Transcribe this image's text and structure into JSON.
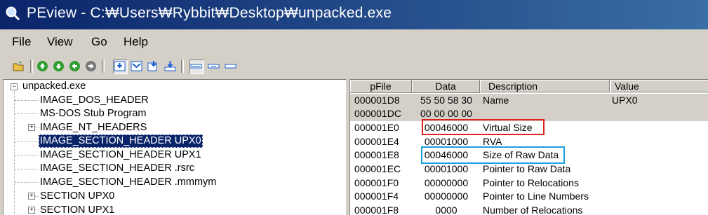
{
  "window": {
    "title": "PEview - C:₩Users₩Rybbit₩Desktop₩unpacked.exe"
  },
  "menu": [
    "File",
    "View",
    "Go",
    "Help"
  ],
  "toolbar": {
    "icons": [
      "open-folder-icon",
      "back-icon",
      "forward-icon",
      "up-icon",
      "down-icon",
      "stop-icon",
      "view-byte-icon",
      "view-word-icon",
      "view-dword-icon",
      "view-qword-icon",
      "layout-1-icon",
      "layout-2-icon",
      "layout-3-icon"
    ],
    "colors": {
      "green": "#2e9d2e",
      "blue": "#1a5fd0",
      "gray": "#606060"
    }
  },
  "tree": {
    "nodes": [
      {
        "label": "unpacked.exe",
        "expander": "−"
      },
      {
        "label": "IMAGE_DOS_HEADER"
      },
      {
        "label": "MS-DOS Stub Program"
      },
      {
        "label": "IMAGE_NT_HEADERS",
        "expander": "+"
      },
      {
        "label": "IMAGE_SECTION_HEADER UPX0",
        "selected": true
      },
      {
        "label": "IMAGE_SECTION_HEADER UPX1"
      },
      {
        "label": "IMAGE_SECTION_HEADER .rsrc"
      },
      {
        "label": "IMAGE_SECTION_HEADER .mmmym"
      },
      {
        "label": "SECTION UPX0",
        "expander": "+"
      },
      {
        "label": "SECTION UPX1",
        "expander": "+"
      }
    ]
  },
  "list": {
    "columns": [
      "pFile",
      "Data",
      "Description",
      "Value"
    ],
    "rows": [
      {
        "pfile": "000001D8",
        "data": "55  50  58  30",
        "desc": "Name",
        "value": "UPX0",
        "hi": true
      },
      {
        "pfile": "000001DC",
        "data": "00  00  00  00",
        "desc": "",
        "value": "",
        "hi": true
      },
      {
        "pfile": "000001E0",
        "data": "00046000",
        "desc": "Virtual Size",
        "value": ""
      },
      {
        "pfile": "000001E4",
        "data": "00001000",
        "desc": "RVA",
        "value": ""
      },
      {
        "pfile": "000001E8",
        "data": "00046000",
        "desc": "Size of Raw Data",
        "value": ""
      },
      {
        "pfile": "000001EC",
        "data": "00001000",
        "desc": "Pointer to Raw Data",
        "value": ""
      },
      {
        "pfile": "000001F0",
        "data": "00000000",
        "desc": "Pointer to Relocations",
        "value": ""
      },
      {
        "pfile": "000001F4",
        "data": "00000000",
        "desc": "Pointer to Line Numbers",
        "value": ""
      },
      {
        "pfile": "000001F8",
        "data": "0000",
        "desc": "Number of Relocations",
        "value": ""
      }
    ]
  },
  "annotations": {
    "red": "#e0201a",
    "blue": "#1aa0e0"
  }
}
